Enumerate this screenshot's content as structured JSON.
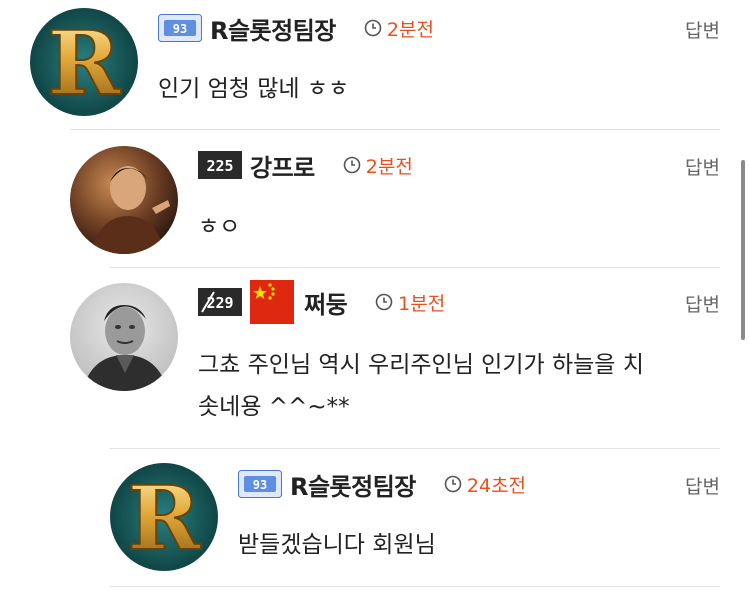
{
  "comments": [
    {
      "author": "R슬롯정팀장",
      "time": "2분전",
      "reply": "답변",
      "text": "인기 엄청 많네 ㅎㅎ",
      "badge": "93"
    },
    {
      "author": "강프로",
      "time": "2분전",
      "reply": "답변",
      "text": "ㅎㅇ",
      "badge": "225"
    },
    {
      "author": "쩌둥",
      "time": "1분전",
      "reply": "답변",
      "text_line1": "그쵸 주인님 역시 우리주인님 인기가 하늘을 치",
      "text_line2": "솟네용 ^^~**",
      "badge": "229"
    },
    {
      "author": "R슬롯정팀장",
      "time": "24초전",
      "reply": "답변",
      "text": "받들겠습니다 회원님",
      "badge": "93"
    }
  ],
  "colors": {
    "time": "#e8501e",
    "reply": "#666666",
    "divider": "#e3e3e3"
  }
}
